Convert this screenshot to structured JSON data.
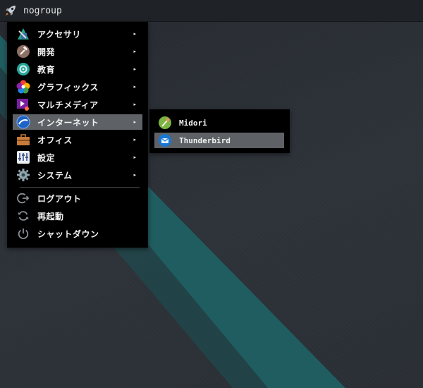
{
  "topbar": {
    "launcher_icon": "rocket-icon",
    "hostname": "nogroup"
  },
  "menu": {
    "items": [
      {
        "label": "アクセサリ",
        "icon": "accessories-icon"
      },
      {
        "label": "開発",
        "icon": "development-icon"
      },
      {
        "label": "教育",
        "icon": "education-icon"
      },
      {
        "label": "グラフィックス",
        "icon": "graphics-icon"
      },
      {
        "label": "マルチメディア",
        "icon": "multimedia-icon"
      },
      {
        "label": "インターネット",
        "icon": "internet-icon"
      },
      {
        "label": "オフィス",
        "icon": "office-icon"
      },
      {
        "label": "設定",
        "icon": "settings-icon"
      },
      {
        "label": "システム",
        "icon": "system-icon"
      }
    ],
    "session": [
      {
        "label": "ログアウト",
        "icon": "logout-icon"
      },
      {
        "label": "再起動",
        "icon": "reboot-icon"
      },
      {
        "label": "シャットダウン",
        "icon": "shutdown-icon"
      }
    ],
    "arrow": "▸",
    "active_item": "インターネット"
  },
  "submenu": {
    "items": [
      {
        "label": "Midori",
        "icon": "midori-icon"
      },
      {
        "label": "Thunderbird",
        "icon": "thunderbird-icon"
      }
    ],
    "active_item": "Thunderbird"
  },
  "colors": {
    "accent_stripe": "#1f5c5f",
    "menu_bg": "#000000",
    "highlight": "#5e6266"
  }
}
